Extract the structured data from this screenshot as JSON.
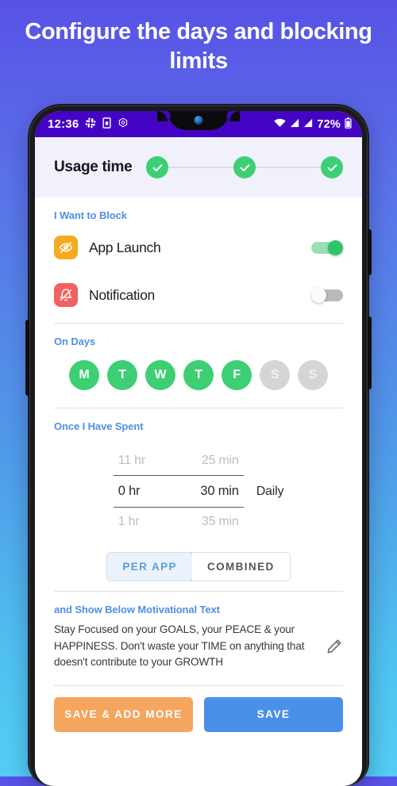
{
  "promo": {
    "headline": "Configure the days and blocking limits"
  },
  "colors": {
    "bg_gradient_top": "#5852e6",
    "bg_gradient_bottom": "#52cdf4",
    "statusbar": "#4404c4",
    "accent_blue": "#4f8fe8",
    "green": "#3ecf74",
    "orange_icon": "#f5ab21",
    "red_icon": "#f2615f",
    "save_orange": "#f5a55e",
    "save_blue": "#4a90e8"
  },
  "statusbar": {
    "time": "12:36",
    "battery_percent": "72%",
    "icons": [
      "slack-icon",
      "sim-card-icon",
      "settings-hex-icon",
      "wifi-icon",
      "signal-bars-icon",
      "signal-bars-icon",
      "battery-icon"
    ]
  },
  "stepper": {
    "title": "Usage time",
    "steps": [
      {
        "state": "complete"
      },
      {
        "state": "complete"
      },
      {
        "state": "complete"
      }
    ]
  },
  "block_section": {
    "label": "I Want to Block",
    "items": [
      {
        "icon": "eye-off-icon",
        "label": "App Launch",
        "enabled": true
      },
      {
        "icon": "bell-off-icon",
        "label": "Notification",
        "enabled": false
      }
    ]
  },
  "days_section": {
    "label": "On Days",
    "days": [
      {
        "letter": "M",
        "selected": true
      },
      {
        "letter": "T",
        "selected": true
      },
      {
        "letter": "W",
        "selected": true
      },
      {
        "letter": "T",
        "selected": true
      },
      {
        "letter": "F",
        "selected": true
      },
      {
        "letter": "S",
        "selected": false
      },
      {
        "letter": "S",
        "selected": false
      }
    ]
  },
  "time_section": {
    "label": "Once I Have Spent",
    "rows": {
      "above": {
        "hour": "11 hr",
        "minute": "25 min"
      },
      "selected": {
        "hour": "0 hr",
        "minute": "30 min"
      },
      "below": {
        "hour": "1 hr",
        "minute": "35 min"
      }
    },
    "unit": "Daily",
    "segment": {
      "options": [
        {
          "label": "PER APP",
          "active": true
        },
        {
          "label": "COMBINED",
          "active": false
        }
      ]
    }
  },
  "motivational_section": {
    "label": "and Show Below Motivational Text",
    "text": "Stay Focused on your GOALS, your PEACE & your HAPPINESS. Don't waste your TIME on anything that doesn't contribute to your GROWTH",
    "edit_icon": "pencil-icon"
  },
  "actions": {
    "save_add_more_label": "SAVE & ADD MORE",
    "save_label": "SAVE"
  }
}
